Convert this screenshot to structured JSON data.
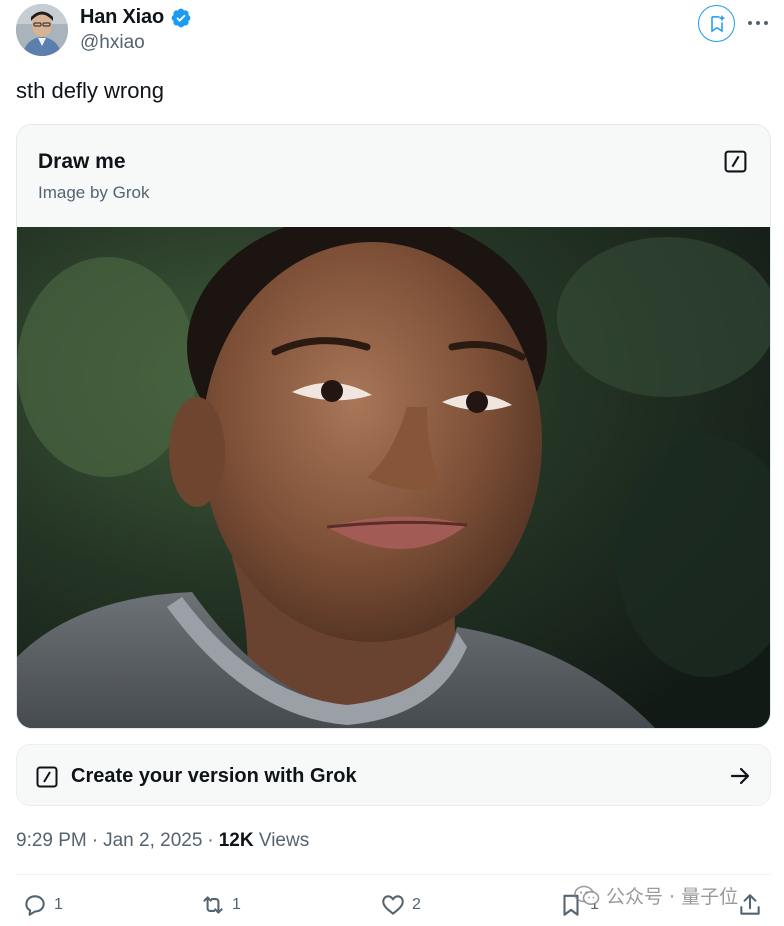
{
  "author": {
    "name": "Han Xiao",
    "handle": "@hxiao",
    "verified": true
  },
  "tweet": {
    "text": "sth defly wrong"
  },
  "card": {
    "title": "Draw me",
    "subtitle": "Image by Grok",
    "edit_icon": "compose-slash-icon"
  },
  "create": {
    "label": "Create your version with Grok"
  },
  "meta": {
    "time": "9:29 PM",
    "separator1": "·",
    "date": "Jan 2, 2025",
    "separator2": "·",
    "views_count": "12K",
    "views_label": "Views"
  },
  "actions": {
    "replies": "1",
    "reposts": "1",
    "likes": "2",
    "bookmarks": "1"
  },
  "watermark": {
    "text": "公众号 · 量子位"
  },
  "colors": {
    "accent": "#1d9bf0",
    "text_primary": "#0f1419",
    "text_secondary": "#536471",
    "card_bg": "#f7f9f9"
  }
}
